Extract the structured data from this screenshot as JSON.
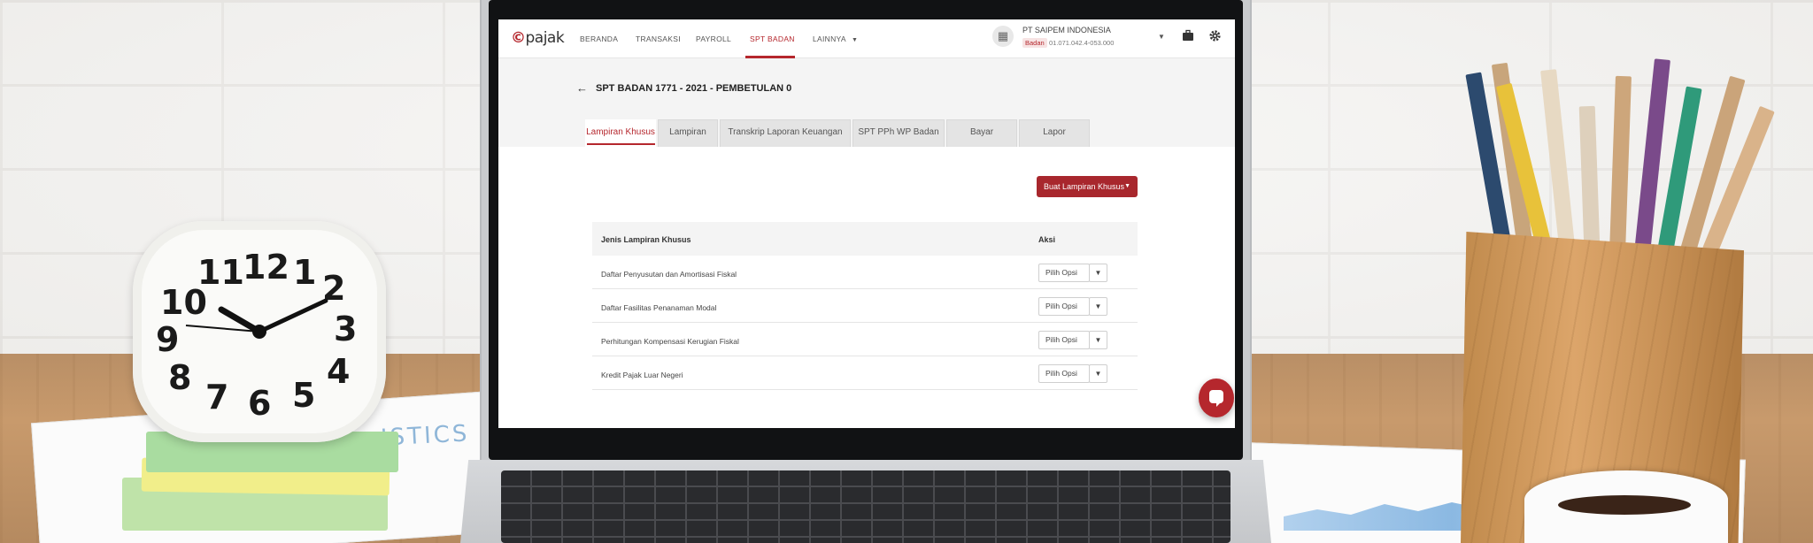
{
  "navbar": {
    "logo_text": "pajak",
    "items": [
      {
        "label": "BERANDA"
      },
      {
        "label": "TRANSAKSI"
      },
      {
        "label": "PAYROLL"
      },
      {
        "label": "SPT BADAN"
      },
      {
        "label": "LAINNYA"
      }
    ],
    "active_item": "SPT BADAN",
    "company": {
      "name": "PT SAIPEM INDONESIA",
      "badge": "Badan",
      "npwp": "01.071.042.4-053.000"
    },
    "icons": [
      "building-icon",
      "chevron-down-icon",
      "briefcase-icon",
      "gear-icon"
    ]
  },
  "page": {
    "title": "SPT BADAN 1771 - 2021 - PEMBETULAN 0",
    "tabs": [
      {
        "label": "Lampiran Khusus"
      },
      {
        "label": "Lampiran"
      },
      {
        "label": "Transkrip Laporan Keuangan"
      },
      {
        "label": "SPT PPh WP Badan"
      },
      {
        "label": "Bayar"
      },
      {
        "label": "Lapor"
      }
    ],
    "active_tab": "Lampiran Khusus",
    "create_button": "Buat Lampiran Khusus",
    "table": {
      "headers": [
        "Jenis Lampiran Khusus",
        "Aksi"
      ],
      "rows": [
        {
          "label": "Daftar Penyusutan dan Amortisasi Fiskal",
          "action": "Pilih Opsi"
        },
        {
          "label": "Daftar Fasilitas Penanaman Modal",
          "action": "Pilih Opsi"
        },
        {
          "label": "Perhitungan Kompensasi Kerugian Fiskal",
          "action": "Pilih Opsi"
        },
        {
          "label": "Kredit Pajak Luar Negeri",
          "action": "Pilih Opsi"
        }
      ]
    }
  },
  "colors": {
    "brand": "#b5272d",
    "button": "#a8272d"
  },
  "scene": {
    "clock_numbers": [
      "11",
      "12",
      "1",
      "2",
      "10",
      "3",
      "9",
      "4",
      "8",
      "5",
      "7",
      "6"
    ],
    "paper_text": "ISTICS"
  }
}
